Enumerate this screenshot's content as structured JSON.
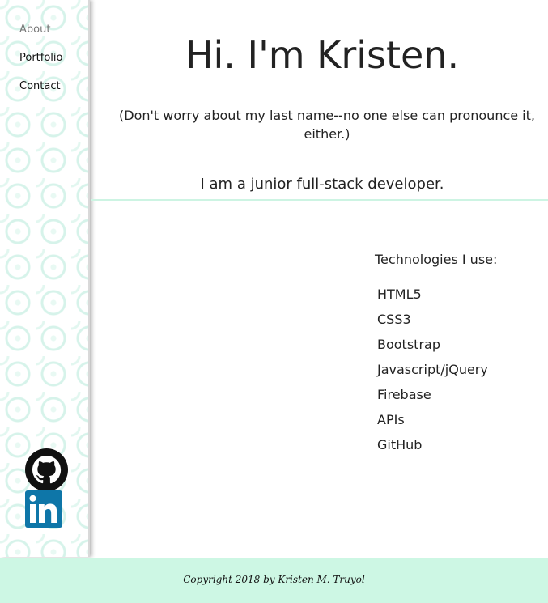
{
  "nav": {
    "items": [
      {
        "label": "About",
        "active": true
      },
      {
        "label": "Portfolio",
        "active": false
      },
      {
        "label": "Contact",
        "active": false
      }
    ]
  },
  "social": {
    "github_icon": "github-icon",
    "linkedin_icon": "linkedin-icon",
    "linkedin_color": "#0e76a8"
  },
  "hero": {
    "title": "Hi. I'm Kristen.",
    "subtitle": "(Don't worry about my last name--no one else can pronounce it, either.)",
    "role": "I am a junior full-stack developer."
  },
  "technologies": {
    "heading": "Technologies I use:",
    "items": [
      "HTML5",
      "CSS3",
      "Bootstrap",
      "Javascript/jQuery",
      "Firebase",
      "APIs",
      "GitHub"
    ]
  },
  "footer": {
    "copyright": "Copyright 2018 by Kristen M. Truyol"
  },
  "colors": {
    "accent_mint": "#cdf7e4",
    "sidebar_pattern": "#d6f3ea"
  }
}
